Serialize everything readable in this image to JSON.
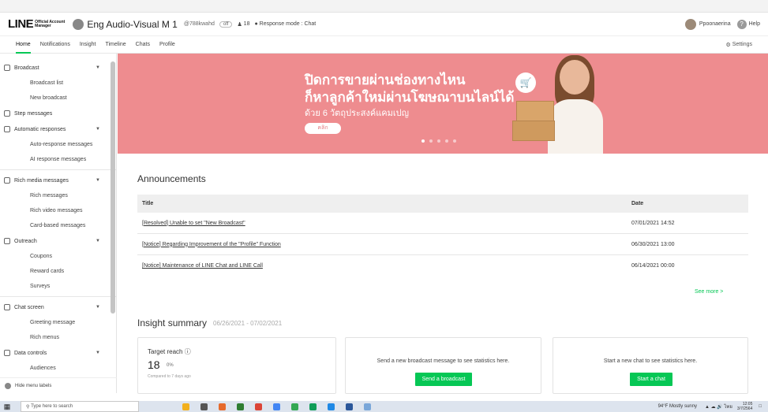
{
  "header": {
    "logo_main": "LINE",
    "logo_sub1": "Official Account",
    "logo_sub2": "Manager",
    "account_name": "Eng Audio-Visual M 1",
    "account_id": "@788kwahd",
    "badge": "off",
    "friends": "18",
    "response_mode": "Response mode : Chat",
    "user_name": "Ppoonaerina",
    "help": "Help"
  },
  "nav": {
    "tabs": [
      "Home",
      "Notifications",
      "Insight",
      "Timeline",
      "Chats",
      "Profile"
    ],
    "settings": "Settings"
  },
  "sidebar": {
    "groups": [
      {
        "label": "Broadcast",
        "items": [
          "Broadcast list",
          "New broadcast"
        ]
      },
      {
        "label": "Step messages",
        "items": []
      },
      {
        "label": "Automatic responses",
        "items": [
          "Auto-response messages",
          "AI response messages"
        ]
      },
      {
        "label": "Rich media messages",
        "items": [
          "Rich messages",
          "Rich video messages",
          "Card-based messages"
        ]
      },
      {
        "label": "Outreach",
        "items": [
          "Coupons",
          "Reward cards",
          "Surveys"
        ]
      },
      {
        "label": "Chat screen",
        "items": [
          "Greeting message",
          "Rich menus"
        ]
      },
      {
        "label": "Data controls",
        "items": [
          "Audiences"
        ]
      }
    ],
    "hide_labels": "Hide menu labels"
  },
  "banner": {
    "line1": "ปิดการขายผ่านช่องทางไหน",
    "line2": "ก็หาลูกค้าใหม่ผ่านโฆษณาบนไลน์ได้",
    "line3": "ด้วย 6 วัตถุประสงค์แคมเปญ",
    "button": "คลิก",
    "slide_count": 5,
    "active_slide": 1
  },
  "announcements": {
    "title": "Announcements",
    "col_title": "Title",
    "col_date": "Date",
    "rows": [
      {
        "title": "[Resolved] Unable to set \"New Broadcast\"",
        "date": "07/01/2021 14:52"
      },
      {
        "title": "[Notice] Regarding Improvement of the \"Profile\" Function",
        "date": "06/30/2021 13:00"
      },
      {
        "title": "[Notice] Maintenance of LINE Chat and LINE Call",
        "date": "06/14/2021 00:00"
      }
    ],
    "see_more": "See more >"
  },
  "insight": {
    "title": "Insight summary",
    "range": "06/26/2021 - 07/02/2021",
    "target_label": "Target reach",
    "target_value": "18",
    "target_unit": "0%",
    "target_note": "Compared to 7 days ago",
    "broadcast_msg": "Send a new broadcast message to see statistics here.",
    "broadcast_btn": "Send a broadcast",
    "chat_msg": "Start a new chat to see statistics here.",
    "chat_btn": "Start a chat"
  },
  "taskbar": {
    "search": "Type here to search",
    "weather": "94°F  Mostly sunny",
    "lang": "ไทย",
    "time": "12:05",
    "date": "3/7/2564"
  },
  "colors": {
    "accent": "#06c755",
    "banner": "#ee8c8f"
  }
}
